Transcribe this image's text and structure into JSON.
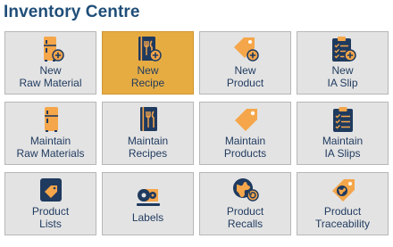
{
  "header": {
    "title": "Inventory Centre"
  },
  "colors": {
    "title": "#1f4e79",
    "tile_bg": "#e3e3e3",
    "tile_active_bg": "#e6ac42",
    "icon_orange": "#f5a64a",
    "icon_navy": "#1f3a5f"
  },
  "tiles": [
    {
      "line1": "New",
      "line2": "Raw Material",
      "icon": "fridge-plus-icon",
      "active": false
    },
    {
      "line1": "New",
      "line2": "Recipe",
      "icon": "recipe-book-plus-icon",
      "active": true
    },
    {
      "line1": "New",
      "line2": "Product",
      "icon": "price-tag-plus-icon",
      "active": false
    },
    {
      "line1": "New",
      "line2": "IA Slip",
      "icon": "clipboard-plus-icon",
      "active": false
    },
    {
      "line1": "Maintain",
      "line2": "Raw Materials",
      "icon": "fridge-icon",
      "active": false
    },
    {
      "line1": "Maintain",
      "line2": "Recipes",
      "icon": "recipe-book-icon",
      "active": false
    },
    {
      "line1": "Maintain",
      "line2": "Products",
      "icon": "price-tag-icon",
      "active": false
    },
    {
      "line1": "Maintain",
      "line2": "IA Slips",
      "icon": "clipboard-icon",
      "active": false
    },
    {
      "line1": "Product",
      "line2": "Lists",
      "icon": "product-list-icon",
      "active": false
    },
    {
      "line1": "Labels",
      "line2": "",
      "icon": "label-roll-icon",
      "active": false
    },
    {
      "line1": "Product",
      "line2": "Recalls",
      "icon": "globe-recall-icon",
      "active": false
    },
    {
      "line1": "Product",
      "line2": "Traceability",
      "icon": "traceability-tag-icon",
      "active": false
    }
  ]
}
